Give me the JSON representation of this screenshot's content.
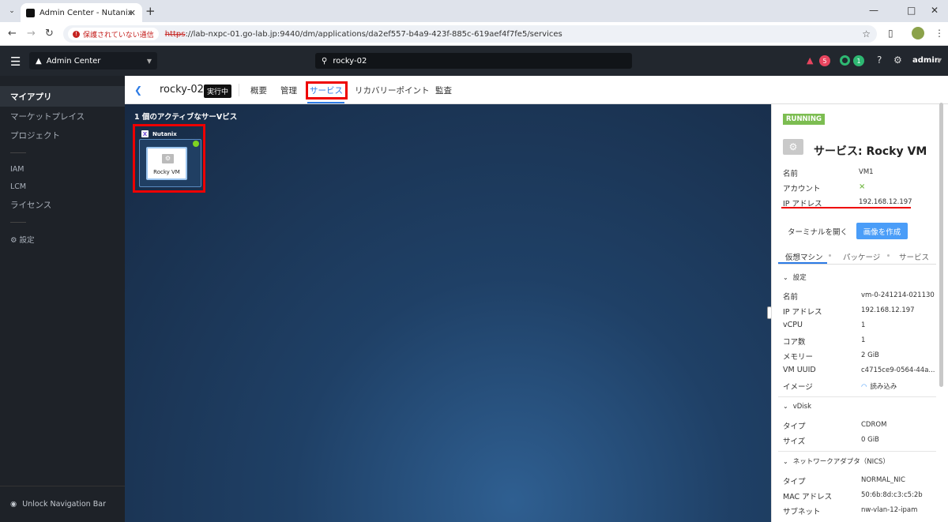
{
  "browser": {
    "tab_title": "Admin Center - Nutanix",
    "security_label": "保護されていない通信",
    "url_scheme": "https",
    "url_rest": "://lab-nxpc-01.go-lab.jp:9440/dm/applications/da2ef557-b4a9-423f-885c-619aef4f7fe5/services"
  },
  "header": {
    "app_switcher": "Admin Center",
    "search_value": "rocky-02",
    "alerts_count": "5",
    "tasks_count": "1",
    "user": "admin"
  },
  "sidebar": {
    "items": [
      "マイアプリ",
      "マーケットプレイス",
      "プロジェクト"
    ],
    "admin_items": [
      "IAM",
      "LCM",
      "ライセンス"
    ],
    "settings": "設定",
    "unlock": "Unlock Navigation Bar"
  },
  "app": {
    "name": "rocky-02",
    "status": "実行中",
    "tabs": [
      "概要",
      "管理",
      "サービス",
      "リカバリーポイント",
      "監査"
    ],
    "active_tab": "サービス"
  },
  "canvas": {
    "title": "1 個のアクティブなサーVビス",
    "group": "Nutanix",
    "service": "Rocky VM"
  },
  "panel": {
    "state": "RUNNING",
    "title": "サービス: Rocky VM",
    "summary": [
      {
        "key": "名前",
        "value": "VM1"
      },
      {
        "key": "アカウント",
        "value": ""
      },
      {
        "key": "IP アドレス",
        "value": "192.168.12.197"
      }
    ],
    "buttons": {
      "terminal": "ターミナルを開く",
      "image": "画像を作成"
    },
    "tabs": [
      "仮想マシン",
      "パッケージ",
      "サービス"
    ],
    "sections": {
      "settings": "設定",
      "vdisk": "vDisk",
      "nics": "ネットワークアダプタ（NICS）"
    },
    "settings_rows": [
      {
        "key": "名前",
        "value": "vm-0-241214-021130"
      },
      {
        "key": "IP アドレス",
        "value": "192.168.12.197"
      },
      {
        "key": "vCPU",
        "value": "1"
      },
      {
        "key": "コア数",
        "value": "1"
      },
      {
        "key": "メモリー",
        "value": "2 GiB"
      },
      {
        "key": "VM UUID",
        "value": "c4715ce9-0564-44a..."
      },
      {
        "key": "イメージ",
        "value": "読み込み"
      }
    ],
    "vdisk_rows": [
      {
        "key": "タイプ",
        "value": "CDROM"
      },
      {
        "key": "サイズ",
        "value": "0 GiB"
      }
    ],
    "nic_rows": [
      {
        "key": "タイプ",
        "value": "NORMAL_NIC"
      },
      {
        "key": "MAC アドレス",
        "value": "50:6b:8d:c3:c5:2b"
      },
      {
        "key": "サブネット",
        "value": "nw-vlan-12-ipam"
      }
    ]
  },
  "colors": {
    "accent": "#2c7be5",
    "running": "#7cbd51",
    "highlight": "#ee0000",
    "alert": "#e8455f"
  }
}
